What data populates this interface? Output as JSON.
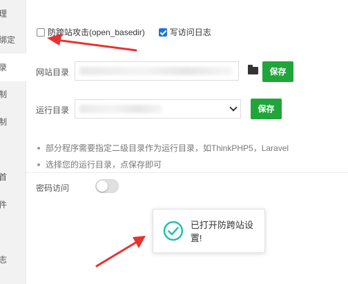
{
  "sidebar": {
    "items": [
      {
        "label": "理"
      },
      {
        "label": "绑定"
      },
      {
        "label": "录"
      },
      {
        "label": "制"
      },
      {
        "label": "制"
      },
      {
        "label": "首"
      },
      {
        "label": "件"
      },
      {
        "label": "志"
      }
    ]
  },
  "options": {
    "anti_xss_label": "防跨站攻击(open_basedir)",
    "anti_xss_checked": false,
    "write_log_label": "写访问日志",
    "write_log_checked": true
  },
  "site_dir": {
    "label": "网站目录",
    "save_label": "保存"
  },
  "run_dir": {
    "label": "运行目录",
    "save_label": "保存"
  },
  "tips": [
    "部分程序需要指定二级目录作为运行目录，如ThinkPHP5，Laravel",
    "选择您的运行目录，点保存即可"
  ],
  "password_access": {
    "label": "密码访问",
    "enabled": false
  },
  "toast": {
    "message": "已打开防跨站设置!"
  },
  "colors": {
    "save_button": "#20a53a",
    "checkbox_checked": "#1a73e8",
    "annotation_arrow": "#e8322f",
    "toast_icon": "#1ec0a8"
  }
}
